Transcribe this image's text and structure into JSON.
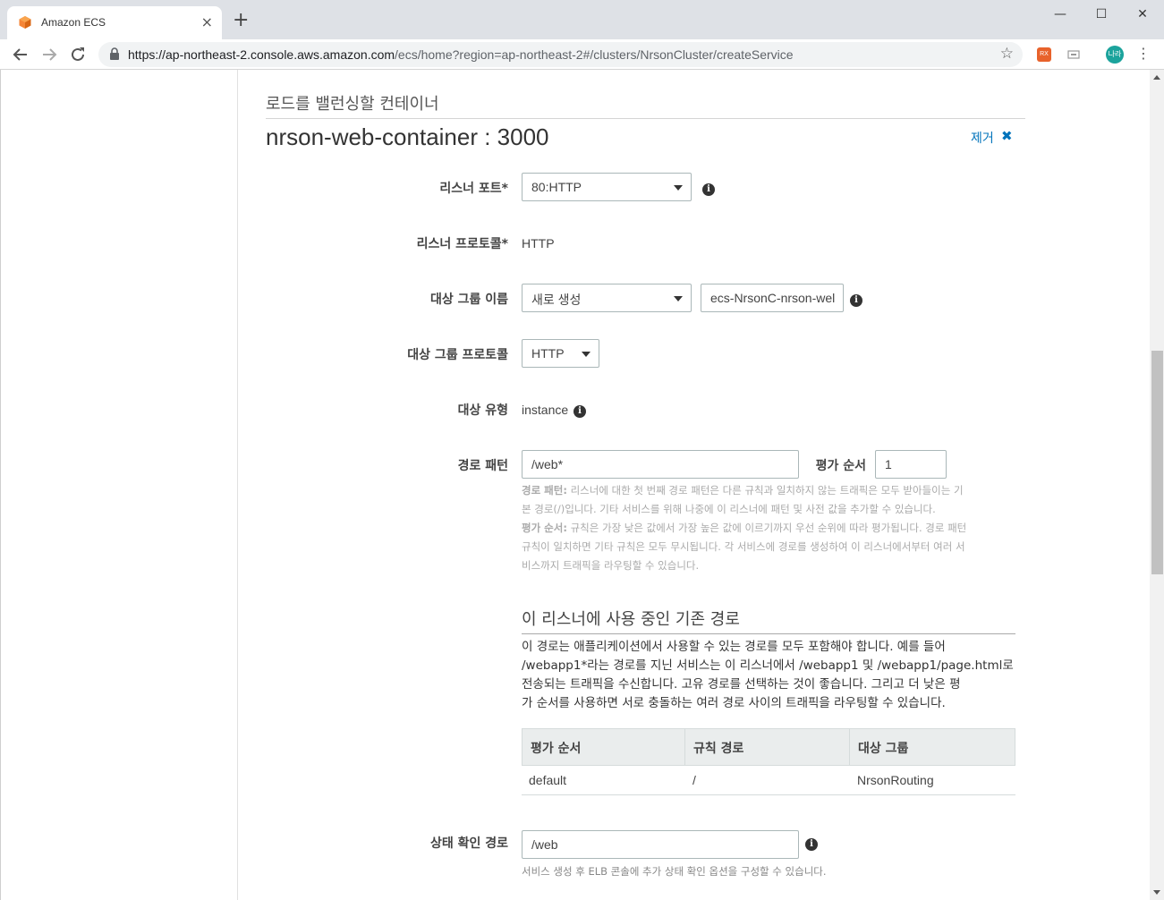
{
  "browser": {
    "tab_title": "Amazon ECS",
    "tab_close": "×",
    "new_tab": "+",
    "url_main": "https://ap-northeast-2.console.aws.amazon.com",
    "url_path": "/ecs/home?region=ap-northeast-2#/clusters/NrsonCluster/createService",
    "ext1": "RX",
    "avatar": "나라",
    "minimize": "—",
    "maximize": "☐",
    "close": "✕"
  },
  "page": {
    "section_title": "로드를 밸런싱할 컨테이너",
    "container_title": "nrson-web-container : 3000",
    "remove_label": "제거",
    "remove_x": "✖",
    "listener_port": {
      "label": "리스너 포트*",
      "value": "80:HTTP"
    },
    "listener_protocol": {
      "label": "리스너 프로토콜*",
      "value": "HTTP"
    },
    "target_group_name": {
      "label": "대상 그룹 이름",
      "select_value": "새로 생성",
      "input_value": "ecs-NrsonC-nrson-wel"
    },
    "target_group_protocol": {
      "label": "대상 그룹 프로토콜",
      "value": "HTTP"
    },
    "target_type": {
      "label": "대상 유형",
      "value": "instance"
    },
    "path_pattern": {
      "label": "경로 패턴",
      "value": "/web*",
      "eval_label": "평가 순서",
      "eval_value": "1"
    },
    "help_path_bold": "경로 패턴:",
    "help_path_text_1": " 리스너에 대한 첫 번째 경로 패턴은 다른 규칙과 일치하지 않는 트래픽은 모두 받아들이는 기",
    "help_path_text_2": "본 경로(/)입니다. 기타 서비스를 위해 나중에 이 리스너에 패턴 및 사전 값을 추가할 수 있습니다.",
    "help_eval_bold": "평가 순서:",
    "help_eval_text_1": " 규칙은 가장 낮은 값에서 가장 높은 값에 이르기까지 우선 순위에 따라 평가됩니다. 경로 패턴",
    "help_eval_text_2": "규칙이 일치하면 기타 규칙은 모두 무시됩니다. 각 서비스에 경로를 생성하여 이 리스너에서부터 여러 서",
    "help_eval_text_3": "비스까지 트래픽을 라우팅할 수 있습니다.",
    "existing_title": "이 리스너에 사용 중인 기존 경로",
    "existing_desc_1": "이 경로는 애플리케이션에서 사용할 수 있는 경로를 모두 포함해야 합니다. 예를 들어",
    "existing_desc_2": "/webapp1*라는 경로를 지닌 서비스는 이 리스너에서 /webapp1 및 /webapp1/page.html로",
    "existing_desc_3": "전송되는 트래픽을 수신합니다. 고유 경로를 선택하는 것이 좋습니다. 그리고 더 낮은 평",
    "existing_desc_4": "가 순서를 사용하면 서로 충돌하는 여러 경로 사이의 트래픽을 라우팅할 수 있습니다.",
    "table": {
      "headers": [
        "평가 순서",
        "규칙 경로",
        "대상 그룹"
      ],
      "rows": [
        [
          "default",
          "/",
          "NrsonRouting"
        ]
      ]
    },
    "health_check": {
      "label": "상태 확인 경로",
      "value": "/web",
      "help": "서비스 생성 후 ELB 콘솔에 추가 상태 확인 옵션을 구성할 수 있습니다."
    }
  }
}
